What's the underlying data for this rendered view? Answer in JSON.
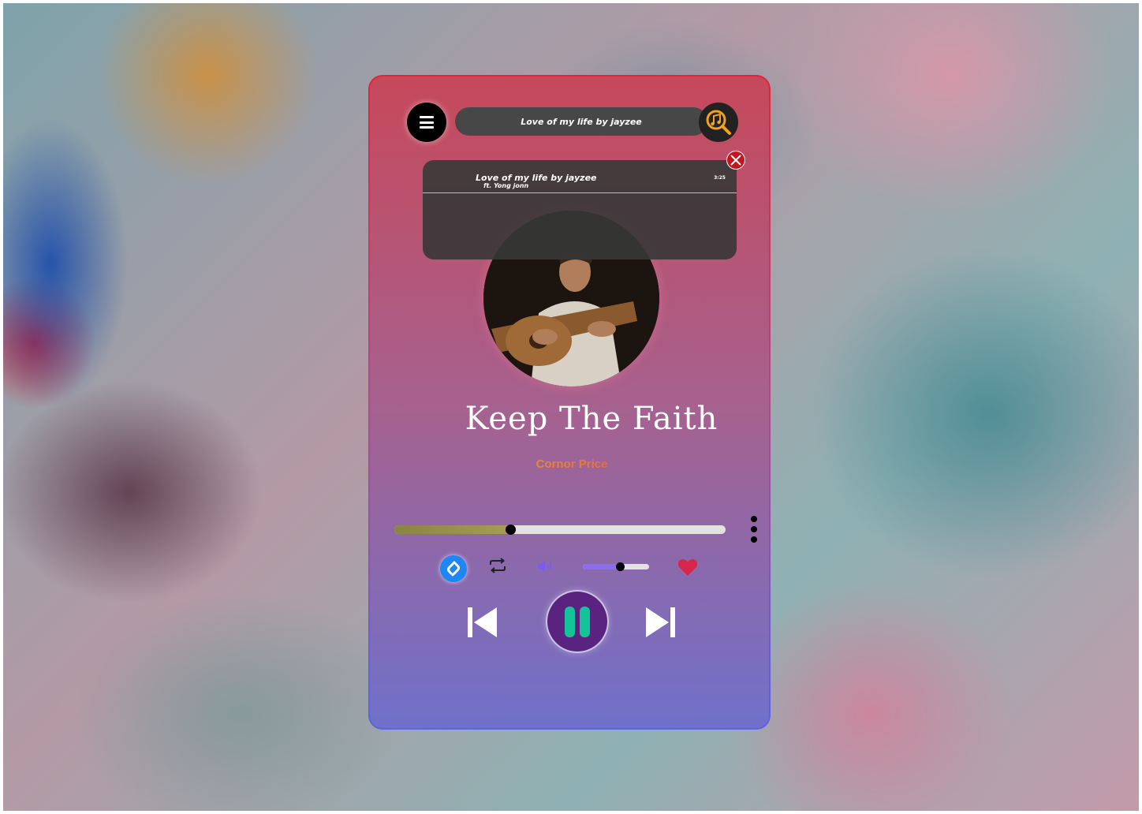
{
  "search": {
    "value": "Love of my life by jayzee"
  },
  "dropdown": {
    "title": "Love of my life by jayzee",
    "subtitle": "ft. Yong jonn",
    "duration": "3:25"
  },
  "now_playing": {
    "title": "Keep The Faith",
    "artist": "Cornor Price",
    "progress": 0.35,
    "volume": 0.56,
    "liked": true,
    "playing": true
  },
  "colors": {
    "accent_purple": "#5a2380",
    "play_bars": "#13c49b",
    "heart": "#d6274a",
    "shazam": "#1f87f5",
    "volume_fill": "#8b6ef0",
    "close": "#c4141d"
  },
  "icons": {
    "menu": "menu-icon",
    "search": "music-search-icon",
    "close": "close-icon",
    "shazam": "shazam-icon",
    "repeat": "repeat-icon",
    "volume": "volume-icon",
    "like": "heart-icon",
    "previous": "skip-previous-icon",
    "next": "skip-next-icon",
    "pause": "pause-icon",
    "more": "more-vertical-icon"
  }
}
